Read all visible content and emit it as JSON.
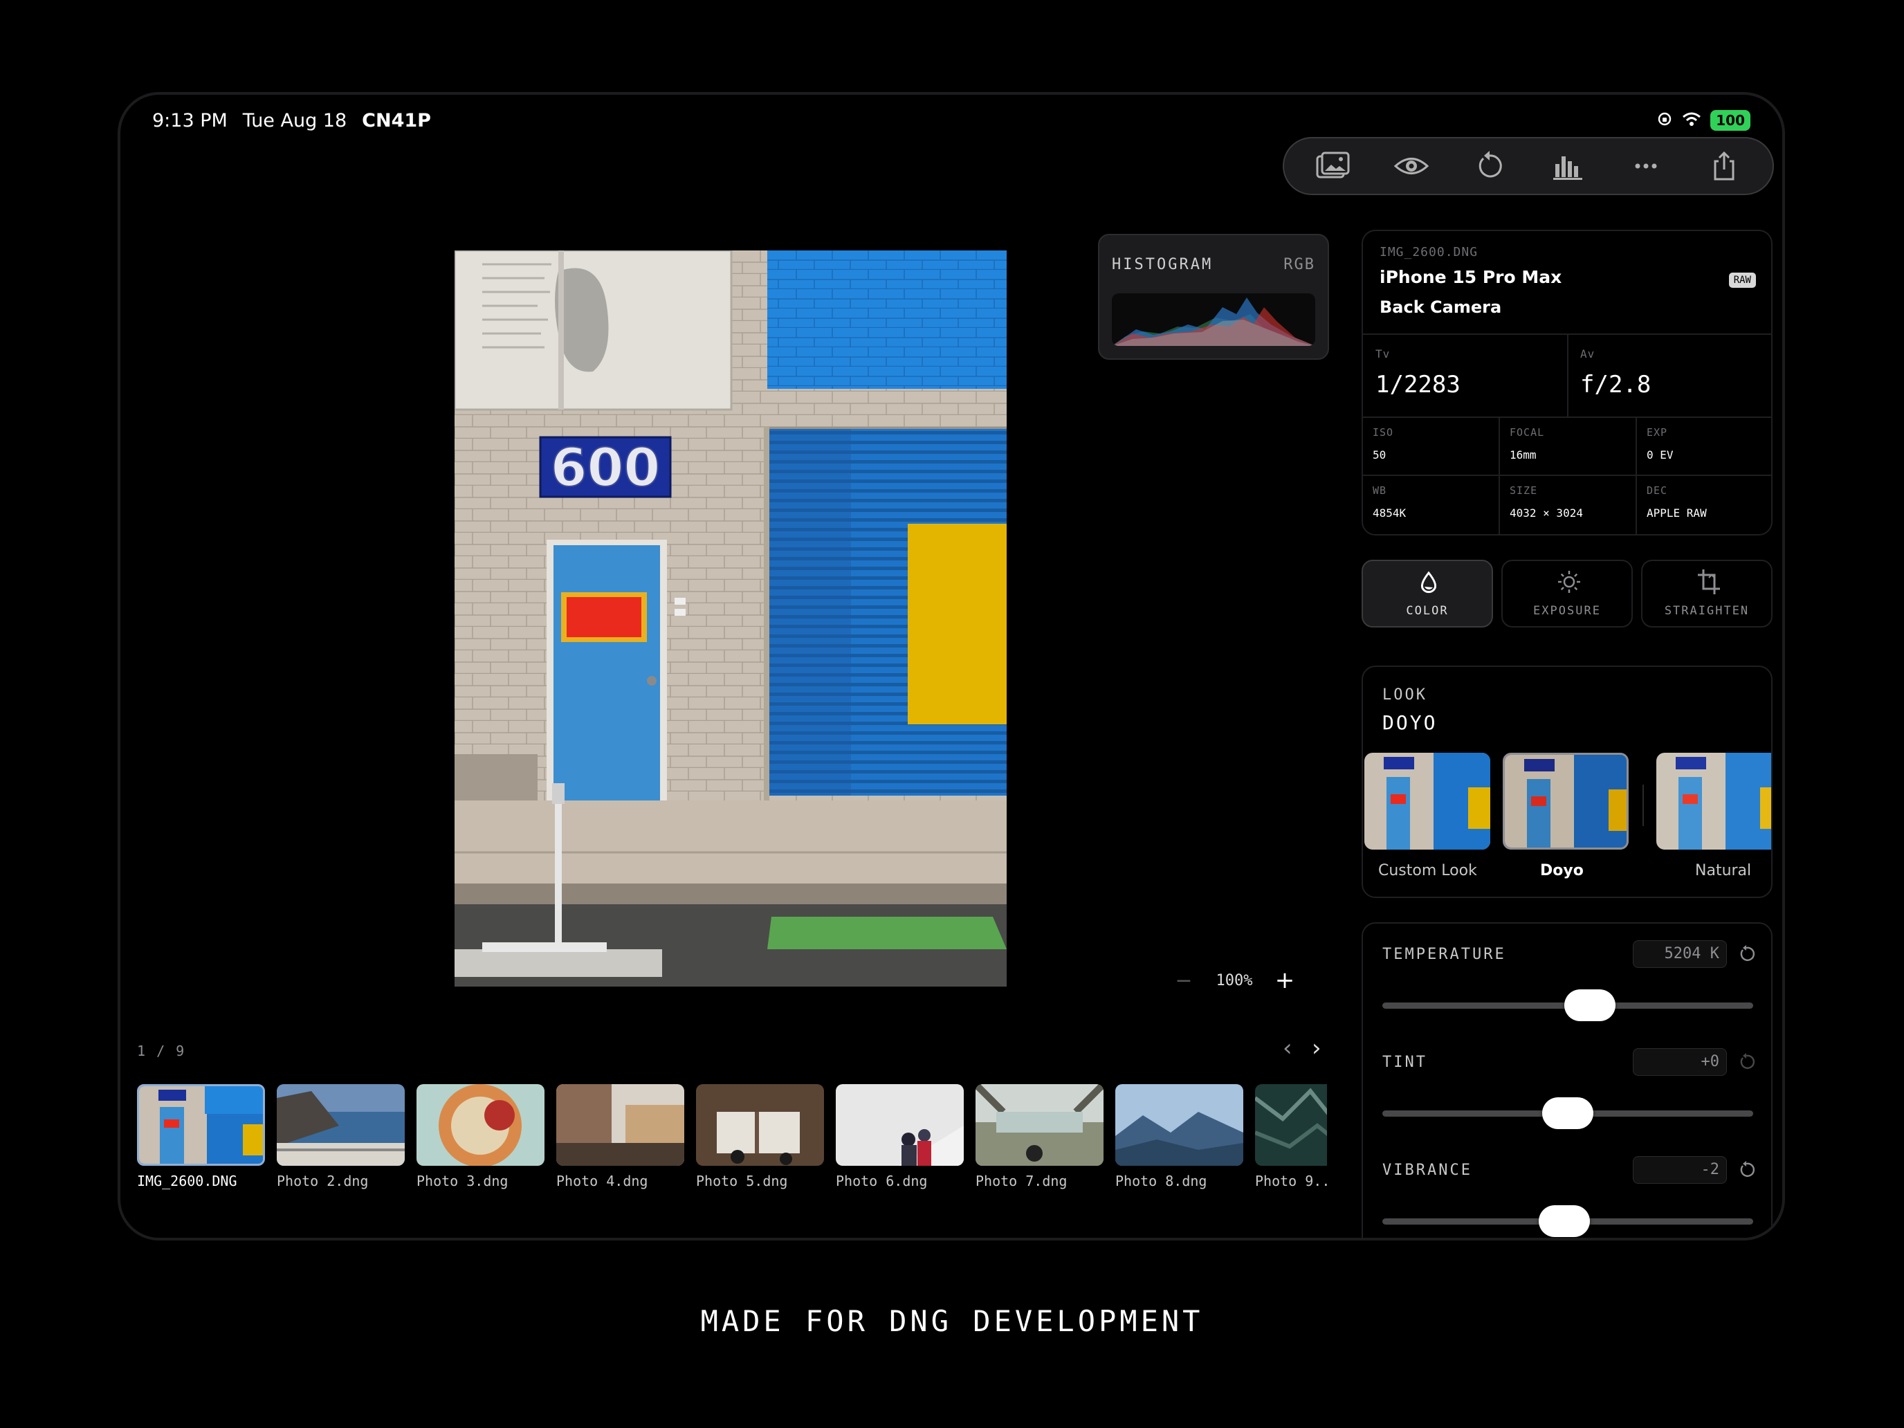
{
  "status": {
    "time": "9:13 PM",
    "date": "Tue Aug 18",
    "carrier": "CN41P",
    "battery": "100"
  },
  "toolbar": {
    "icons": [
      "gallery-icon",
      "eye-icon",
      "undo-icon",
      "histogram-icon",
      "more-icon",
      "share-icon"
    ]
  },
  "histogram": {
    "title": "HISTOGRAM",
    "mode": "RGB"
  },
  "zoom": {
    "minus": "−",
    "value": "100%",
    "plus": "+"
  },
  "filmstrip": {
    "pager": "1 / 9",
    "prev": "‹",
    "next": "›",
    "items": [
      {
        "label": "IMG_2600.DNG"
      },
      {
        "label": "Photo 2.dng"
      },
      {
        "label": "Photo 3.dng"
      },
      {
        "label": "Photo 4.dng"
      },
      {
        "label": "Photo 5.dng"
      },
      {
        "label": "Photo 6.dng"
      },
      {
        "label": "Photo 7.dng"
      },
      {
        "label": "Photo 8.dng"
      },
      {
        "label": "Photo 9.."
      }
    ]
  },
  "meta": {
    "filename": "IMG_2600.DNG",
    "camera": "iPhone 15 Pro Max",
    "lens": "Back Camera",
    "badge": "RAW",
    "tv_label": "Tv",
    "tv": "1/2283",
    "av_label": "Av",
    "av": "f/2.8",
    "iso_label": "ISO",
    "iso": "50",
    "focal_label": "FOCAL",
    "focal": "16mm",
    "exp_label": "EXP",
    "exp": "0 EV",
    "wb_label": "WB",
    "wb": "4854K",
    "size_label": "SIZE",
    "size": "4032 × 3024",
    "dec_label": "DEC",
    "dec": "APPLE RAW"
  },
  "tools": {
    "color": "COLOR",
    "exposure": "EXPOSURE",
    "straighten": "STRAIGHTEN"
  },
  "look": {
    "header": "LOOK",
    "current": "DOYO",
    "options": [
      "Custom Look",
      "Doyo",
      "Natural"
    ]
  },
  "adjust": {
    "temperature": {
      "label": "TEMPERATURE",
      "value": "5204 K",
      "level": 0.56
    },
    "tint": {
      "label": "TINT",
      "value": "+0",
      "level": 0.5
    },
    "vibrance": {
      "label": "VIBRANCE",
      "value": "-2",
      "level": 0.49
    }
  },
  "colors": {
    "accent": "#30d158",
    "panel": "#1c1c1e",
    "door_blue": "#3d8fd0",
    "wall_blue": "#1f7fd8",
    "yellow": "#e0b300",
    "red": "#e8321e"
  },
  "tagline": "MADE FOR DNG DEVELOPMENT"
}
